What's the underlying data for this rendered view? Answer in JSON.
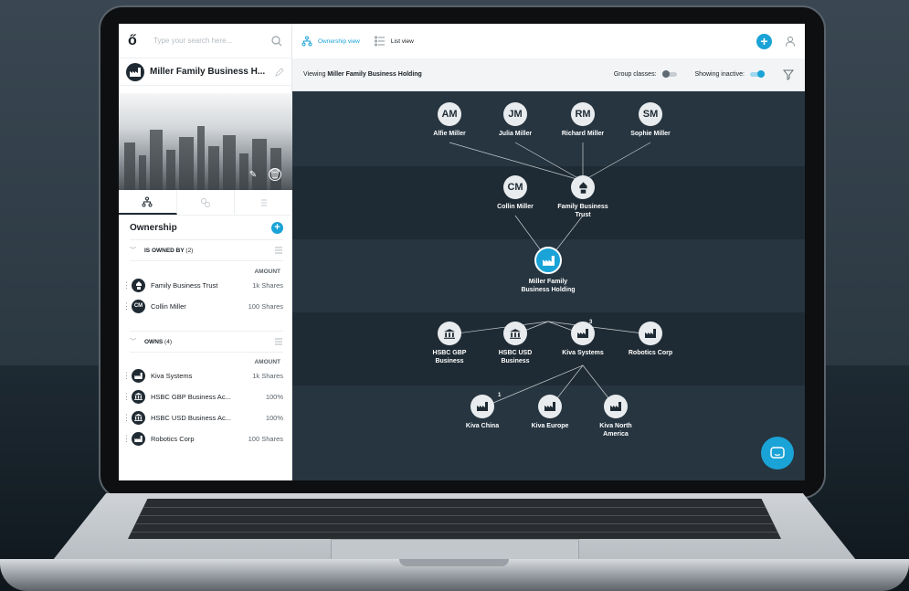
{
  "search": {
    "placeholder": "Type your search here..."
  },
  "entity": {
    "name": "Miller Family Business H..."
  },
  "ownership": {
    "title": "Ownership",
    "owned_by": {
      "label": "IS OWNED BY",
      "count": "(2)",
      "amount_header": "AMOUNT",
      "rows": [
        {
          "name": "Family Business Trust",
          "amount": "1k Shares",
          "initials": ""
        },
        {
          "name": "Collin Miller",
          "amount": "100 Shares",
          "initials": "CM"
        }
      ]
    },
    "owns": {
      "label": "OWNS",
      "count": "(4)",
      "amount_header": "AMOUNT",
      "rows": [
        {
          "name": "Kiva Systems",
          "amount": "1k Shares"
        },
        {
          "name": "HSBC GBP Business Ac...",
          "amount": "100%"
        },
        {
          "name": "HSBC USD Business Ac...",
          "amount": "100%"
        },
        {
          "name": "Robotics Corp",
          "amount": "100 Shares"
        }
      ]
    }
  },
  "topbar": {
    "ownership_view": "Ownership view",
    "list_view": "List view"
  },
  "subbar": {
    "viewing_prefix": "Viewing",
    "viewing_entity": "Miller Family Business Holding",
    "group_classes": "Group classes:",
    "showing_inactive": "Showing inactive:"
  },
  "graph": {
    "persons": [
      {
        "initials": "AM",
        "name": "Alfie Miller"
      },
      {
        "initials": "JM",
        "name": "Julia Miller"
      },
      {
        "initials": "RM",
        "name": "Richard Miller"
      },
      {
        "initials": "SM",
        "name": "Sophie Miller"
      }
    ],
    "level2": [
      {
        "initials": "CM",
        "name": "Collin Miller"
      },
      {
        "initials": "",
        "name": "Family Business Trust"
      }
    ],
    "center": {
      "name": "Miller Family Business Holding"
    },
    "level4": [
      {
        "name": "HSBC GBP Business"
      },
      {
        "name": "HSBC USD Business"
      },
      {
        "name": "Kiva Systems",
        "badge": "3"
      },
      {
        "name": "Robotics Corp"
      }
    ],
    "level5": [
      {
        "name": "Kiva China",
        "badge": "1"
      },
      {
        "name": "Kiva Europe"
      },
      {
        "name": "Kiva North America"
      }
    ]
  },
  "colors": {
    "accent": "#1aa3d6",
    "canvas": "#1f2b34"
  }
}
